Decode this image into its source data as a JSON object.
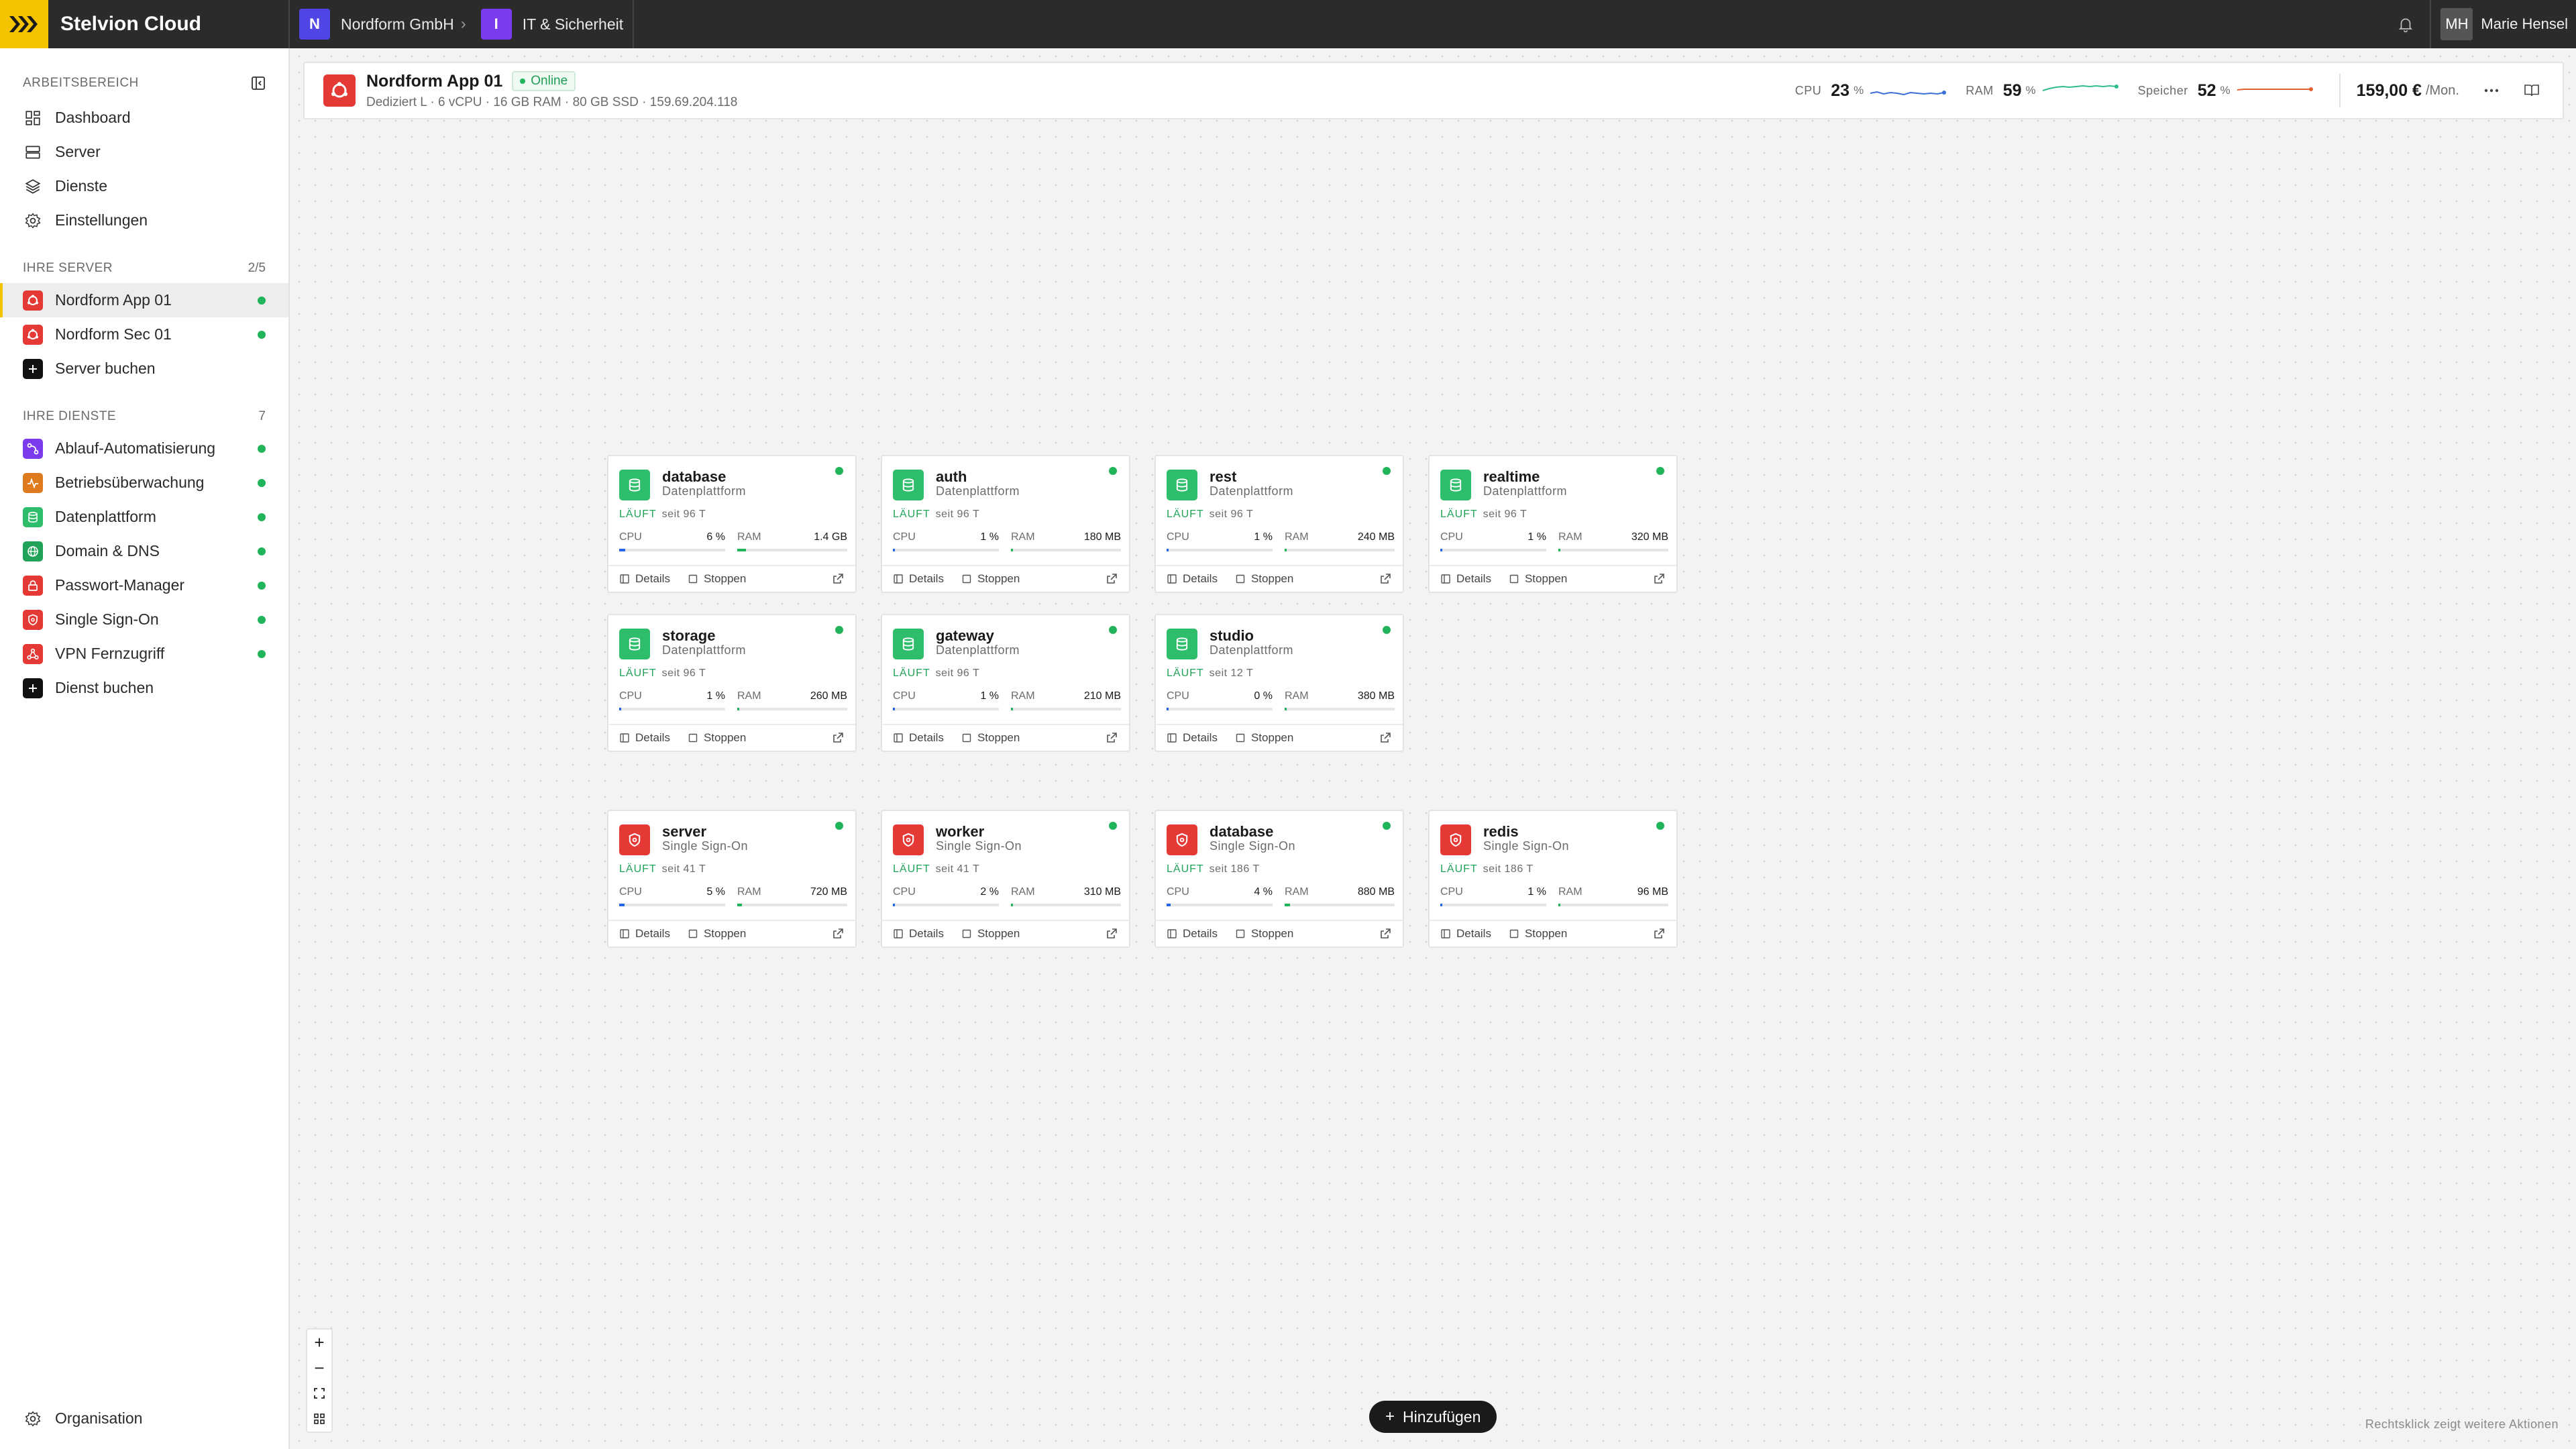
{
  "topbar": {
    "brand": "Stelvion Cloud",
    "org": {
      "badge": "N",
      "label": "Nordform GmbH",
      "color": "#4f46e5"
    },
    "project": {
      "badge": "I",
      "label": "IT & Sicherheit",
      "color": "#7c3aed"
    },
    "user": {
      "initials": "MH",
      "name": "Marie Hensel"
    }
  },
  "sidebar": {
    "workspace_caption": "ARBEITSBEREICH",
    "nav": [
      {
        "label": "Dashboard",
        "icon": "dashboard-icon"
      },
      {
        "label": "Server",
        "icon": "server-icon"
      },
      {
        "label": "Dienste",
        "icon": "layers-icon"
      },
      {
        "label": "Einstellungen",
        "icon": "gear-icon"
      }
    ],
    "servers_caption": "IHRE SERVER",
    "servers_count": "2/5",
    "servers": [
      {
        "label": "Nordform App 01",
        "status": "online"
      },
      {
        "label": "Nordform Sec 01",
        "status": "online"
      }
    ],
    "book_server": "Server buchen",
    "services_caption": "IHRE DIENSTE",
    "services_count": "7",
    "services": [
      {
        "label": "Ablauf-Automatisierung",
        "color": "#7c3aed",
        "icon": "workflow-icon"
      },
      {
        "label": "Betriebsüberwachung",
        "color": "#e07a1f",
        "icon": "pulse-icon"
      },
      {
        "label": "Datenplattform",
        "color": "#2ebd6b",
        "icon": "database-icon"
      },
      {
        "label": "Domain & DNS",
        "color": "#22a35a",
        "icon": "globe-icon"
      },
      {
        "label": "Passwort-Manager",
        "color": "#e53935",
        "icon": "lock-icon"
      },
      {
        "label": "Single Sign-On",
        "color": "#e53935",
        "icon": "shield-icon"
      },
      {
        "label": "VPN Fernzugriff",
        "color": "#e53935",
        "icon": "vpn-icon"
      }
    ],
    "book_service": "Dienst buchen",
    "organisation": "Organisation"
  },
  "server_card": {
    "title": "Nordform App 01",
    "status": "Online",
    "subtitle": "Dediziert L · 6 vCPU · 16 GB RAM · 80 GB SSD · 159.69.204.118",
    "cpu": {
      "label": "CPU",
      "value": "23",
      "unit": "%"
    },
    "ram": {
      "label": "RAM",
      "value": "59",
      "unit": "%"
    },
    "storage": {
      "label": "Speicher",
      "value": "52",
      "unit": "%"
    },
    "price": "159,00 €",
    "price_unit": "/Mon.",
    "colors": {
      "cpu": "#3b6fd8",
      "ram": "#2ebd8a",
      "storage": "#e0612f"
    }
  },
  "service_cards": [
    {
      "name": "database",
      "type": "Datenplattform",
      "kind": "data",
      "status": "LÄUFT",
      "since": "seit 96 T",
      "cpu": "6 %",
      "cpu_pct": 6,
      "ram": "1.4 GB",
      "ram_pct": 8
    },
    {
      "name": "auth",
      "type": "Datenplattform",
      "kind": "data",
      "status": "LÄUFT",
      "since": "seit 96 T",
      "cpu": "1 %",
      "cpu_pct": 1,
      "ram": "180 MB",
      "ram_pct": 2
    },
    {
      "name": "rest",
      "type": "Datenplattform",
      "kind": "data",
      "status": "LÄUFT",
      "since": "seit 96 T",
      "cpu": "1 %",
      "cpu_pct": 1,
      "ram": "240 MB",
      "ram_pct": 2
    },
    {
      "name": "realtime",
      "type": "Datenplattform",
      "kind": "data",
      "status": "LÄUFT",
      "since": "seit 96 T",
      "cpu": "1 %",
      "cpu_pct": 1,
      "ram": "320 MB",
      "ram_pct": 2
    },
    {
      "name": "storage",
      "type": "Datenplattform",
      "kind": "data",
      "status": "LÄUFT",
      "since": "seit 96 T",
      "cpu": "1 %",
      "cpu_pct": 1,
      "ram": "260 MB",
      "ram_pct": 2
    },
    {
      "name": "gateway",
      "type": "Datenplattform",
      "kind": "data",
      "status": "LÄUFT",
      "since": "seit 96 T",
      "cpu": "1 %",
      "cpu_pct": 1,
      "ram": "210 MB",
      "ram_pct": 2
    },
    {
      "name": "studio",
      "type": "Datenplattform",
      "kind": "data",
      "status": "LÄUFT",
      "since": "seit 12 T",
      "cpu": "0 %",
      "cpu_pct": 0,
      "ram": "380 MB",
      "ram_pct": 2
    },
    {
      "name": "server",
      "type": "Single Sign-On",
      "kind": "sso",
      "status": "LÄUFT",
      "since": "seit 41 T",
      "cpu": "5 %",
      "cpu_pct": 5,
      "ram": "720 MB",
      "ram_pct": 4
    },
    {
      "name": "worker",
      "type": "Single Sign-On",
      "kind": "sso",
      "status": "LÄUFT",
      "since": "seit 41 T",
      "cpu": "2 %",
      "cpu_pct": 2,
      "ram": "310 MB",
      "ram_pct": 2
    },
    {
      "name": "database",
      "type": "Single Sign-On",
      "kind": "sso",
      "status": "LÄUFT",
      "since": "seit 186 T",
      "cpu": "4 %",
      "cpu_pct": 4,
      "ram": "880 MB",
      "ram_pct": 5
    },
    {
      "name": "redis",
      "type": "Single Sign-On",
      "kind": "sso",
      "status": "LÄUFT",
      "since": "seit 186 T",
      "cpu": "1 %",
      "cpu_pct": 1,
      "ram": "96 MB",
      "ram_pct": 1
    }
  ],
  "card_labels": {
    "cpu": "CPU",
    "ram": "RAM",
    "details": "Details",
    "stop": "Stoppen"
  },
  "add_button": "Hinzufügen",
  "hint": "Rechtsklick zeigt weitere Aktionen",
  "colors": {
    "data": "#2ebd6b",
    "sso": "#e53935",
    "accent": "#f5c400",
    "cpu_bar": "#2563eb",
    "ram_bar": "#22b45a"
  }
}
